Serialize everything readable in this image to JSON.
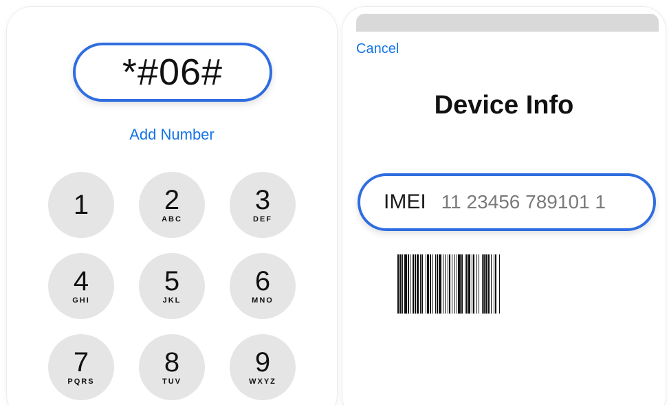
{
  "dialer": {
    "display_value": "*#06#",
    "add_number_label": "Add Number",
    "keys": [
      {
        "digit": "1",
        "letters": ""
      },
      {
        "digit": "2",
        "letters": "ABC"
      },
      {
        "digit": "3",
        "letters": "DEF"
      },
      {
        "digit": "4",
        "letters": "GHI"
      },
      {
        "digit": "5",
        "letters": "JKL"
      },
      {
        "digit": "6",
        "letters": "MNO"
      },
      {
        "digit": "7",
        "letters": "PQRS"
      },
      {
        "digit": "8",
        "letters": "TUV"
      },
      {
        "digit": "9",
        "letters": "WXYZ"
      }
    ]
  },
  "device_info": {
    "cancel_label": "Cancel",
    "title": "Device Info",
    "imei_label": "IMEI",
    "imei_value": "11 23456 789101 1",
    "barcode_icon": "barcode-icon"
  },
  "colors": {
    "accent_blue": "#1473e6",
    "highlight_border": "#2f6de0",
    "key_background": "#e5e5e5"
  }
}
